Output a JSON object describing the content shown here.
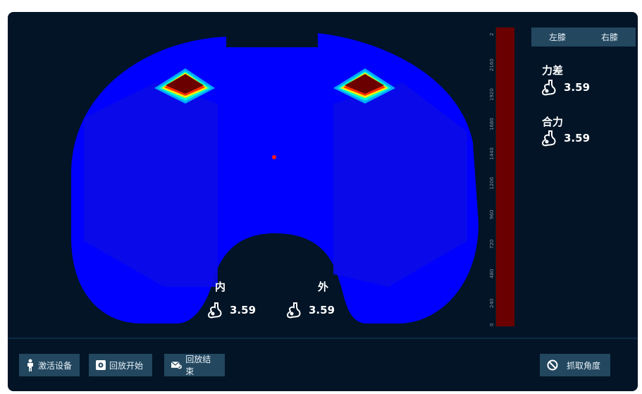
{
  "tabs": {
    "left_knee": "左膝",
    "right_knee": "右膝"
  },
  "metrics": {
    "force_diff": {
      "label": "力差",
      "value": "3.59"
    },
    "resultant": {
      "label": "合力",
      "value": "3.59"
    },
    "inner": {
      "label": "内",
      "value": "3.59"
    },
    "outer": {
      "label": "外",
      "value": "3.59"
    }
  },
  "scale_ticks": [
    "2",
    "2160",
    "1920",
    "1680",
    "1440",
    "1200",
    "960",
    "720",
    "480",
    "240",
    "0"
  ],
  "buttons": {
    "activate": "激活设备",
    "replay_start": "回放开始",
    "replay_end": "回放结束",
    "capture_angle": "抓取角度"
  },
  "colors": {
    "panel_bg": "#021426",
    "plate_blue": "#0000ff",
    "hot_red": "#6b0000",
    "button_bg": "#22475f"
  },
  "icons": [
    "person-icon",
    "gear-icon",
    "envelope-check-icon",
    "no-entry-icon",
    "knee-icon"
  ]
}
